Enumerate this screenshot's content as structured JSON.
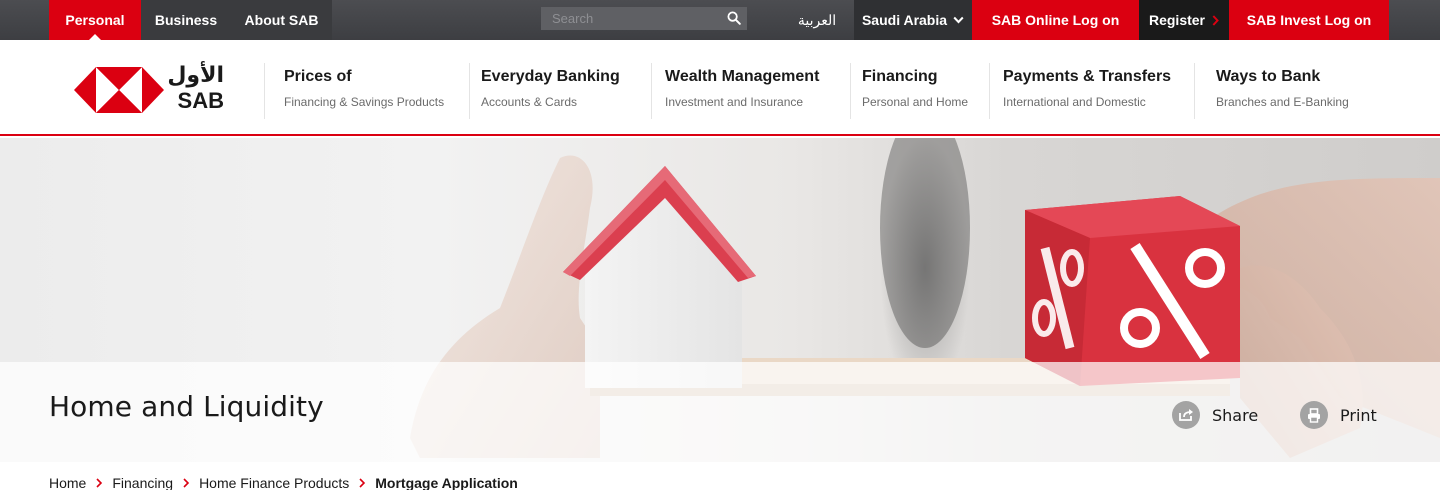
{
  "topbar": {
    "personal": "Personal",
    "business": "Business",
    "about": "About SAB",
    "search_placeholder": "Search",
    "arabic": "العربية",
    "country": "Saudi Arabia",
    "online_logon": "SAB Online Log on",
    "register": "Register",
    "invest_logon": "SAB Invest Log on"
  },
  "logo": {
    "arabic": "الأول",
    "latin": "SAB"
  },
  "nav": [
    {
      "title": "Prices of",
      "sub": "Financing & Savings Products"
    },
    {
      "title": "Everyday Banking",
      "sub": "Accounts & Cards"
    },
    {
      "title": "Wealth Management",
      "sub": "Investment and Insurance"
    },
    {
      "title": "Financing",
      "sub": "Personal and Home"
    },
    {
      "title": "Payments & Transfers",
      "sub": "International and Domestic"
    },
    {
      "title": "Ways to Bank",
      "sub": "Branches and E-Banking"
    }
  ],
  "hero": {
    "title": "Home and Liquidity",
    "share": "Share",
    "print": "Print"
  },
  "breadcrumb": {
    "items": [
      "Home",
      "Financing",
      "Home Finance Products"
    ],
    "current": "Mortgage Application"
  },
  "colors": {
    "brand_red": "#db0011",
    "topbar": "#3d3e42",
    "text": "#1a1a1a"
  },
  "icons": [
    "search-icon",
    "chevron-down-icon",
    "chevron-right-icon",
    "share-icon",
    "print-icon",
    "hexagon-logo-icon"
  ]
}
